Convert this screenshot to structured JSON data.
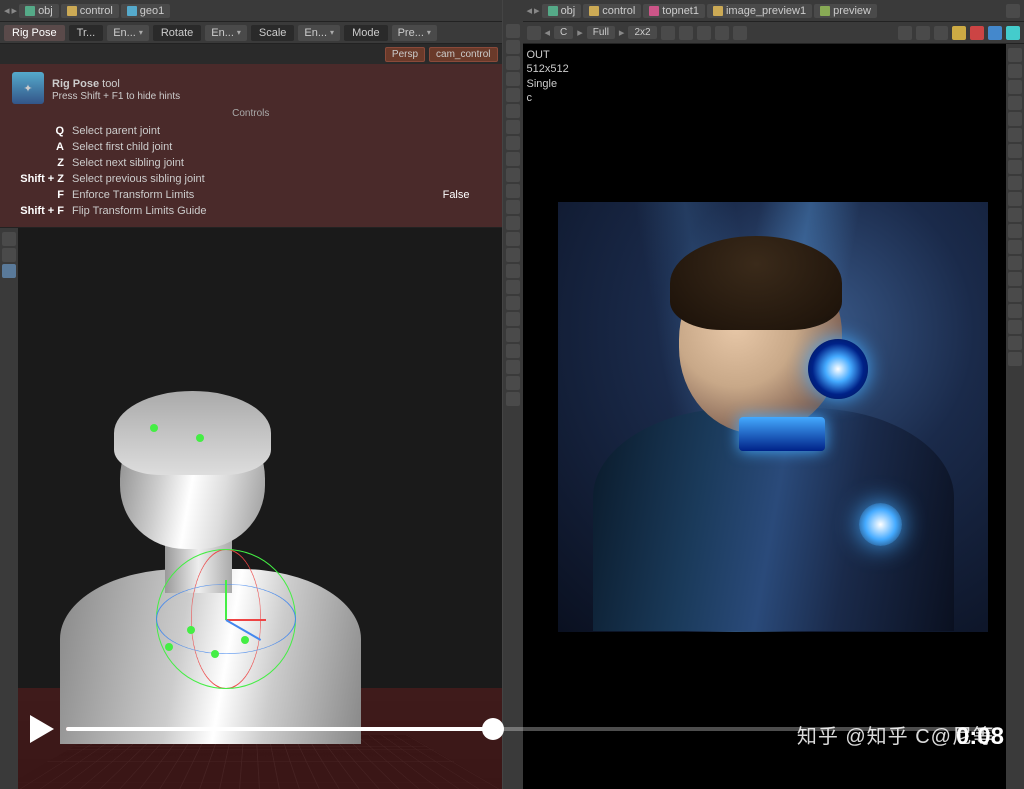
{
  "left": {
    "breadcrumb": [
      {
        "icon": "i-obj",
        "label": "obj"
      },
      {
        "icon": "i-ctrl",
        "label": "control"
      },
      {
        "icon": "i-geo",
        "label": "geo1"
      }
    ],
    "toolbar": {
      "tabs": [
        "Rig Pose",
        "Tr...",
        "En...",
        "Rotate",
        "En...",
        "Scale",
        "En...",
        "Mode",
        "Pre..."
      ]
    },
    "camera": {
      "persp": "Persp",
      "cam": "cam_control"
    },
    "hints": {
      "title_bold": "Rig Pose",
      "title_rest": " tool",
      "subtitle": "Press Shift + F1 to hide hints",
      "controls_label": "Controls",
      "rows": [
        {
          "key": "Q",
          "desc": "Select parent joint"
        },
        {
          "key": "A",
          "desc": "Select first child joint"
        },
        {
          "key": "Z",
          "desc": "Select next sibling joint"
        },
        {
          "key": "Shift + Z",
          "desc": "Select previous sibling joint"
        },
        {
          "key": "F",
          "desc": "Enforce Transform Limits",
          "val": "False"
        },
        {
          "key": "Shift + F",
          "desc": "Flip Transform Limits Guide"
        }
      ]
    }
  },
  "right": {
    "breadcrumb": [
      {
        "icon": "i-obj",
        "label": "obj"
      },
      {
        "icon": "i-ctrl",
        "label": "control"
      },
      {
        "icon": "i-top",
        "label": "topnet1"
      },
      {
        "icon": "i-ctrl",
        "label": "image_preview1"
      },
      {
        "icon": "i-prev",
        "label": "preview"
      }
    ],
    "preview_bar": {
      "c": "C",
      "full": "Full",
      "grid": "2x2"
    },
    "status": {
      "out": "OUT",
      "res": "512x512",
      "mode": "Single",
      "extra": "c"
    }
  },
  "watermark": "知乎 @知乎 C@尼等",
  "timestamp": "0:08"
}
